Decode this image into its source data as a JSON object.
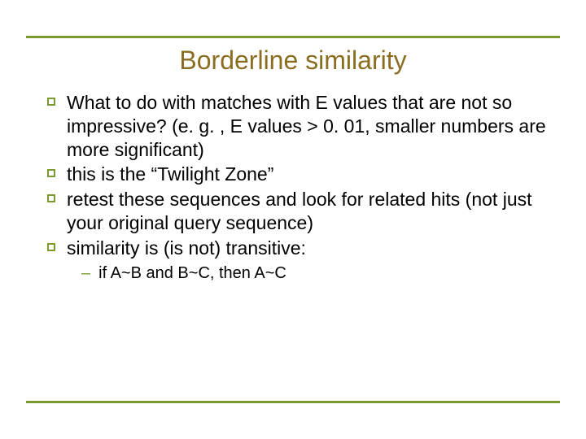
{
  "title": "Borderline similarity",
  "bullets": [
    "What to do with matches with E values that are not so impressive? (e. g. , E values > 0. 01, smaller numbers are more significant)",
    "this is the “Twilight Zone”",
    "retest these sequences and look for related hits (not just your original query sequence)",
    "similarity is (is not) transitive:"
  ],
  "sub": "if A~B and B~C, then A~C"
}
